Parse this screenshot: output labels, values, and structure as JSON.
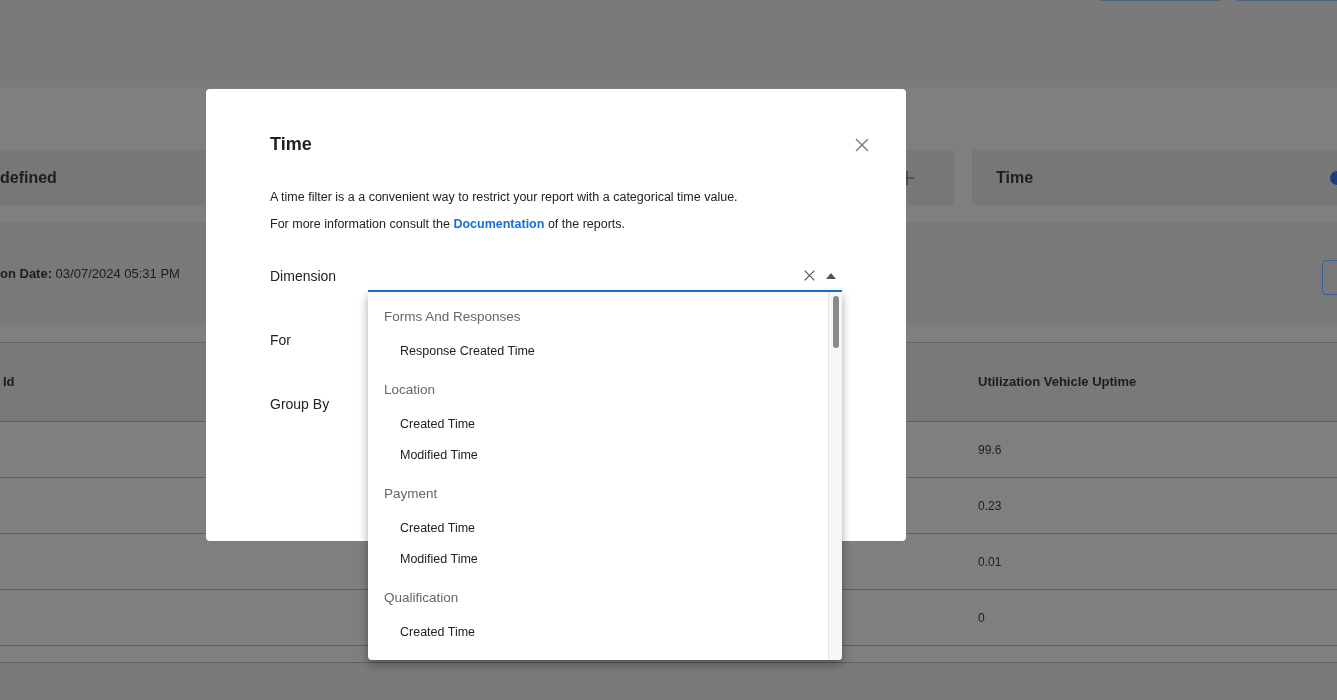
{
  "filter_cards": [
    {
      "kind": "text",
      "label": "defined"
    },
    {
      "kind": "add"
    },
    {
      "kind": "text",
      "label": "Time"
    }
  ],
  "report_info": "**on Date:** 03/07/2024 05:31 PM",
  "table": {
    "columns": [
      "Id",
      "Utilization Vehicle Uptime"
    ],
    "rows": [
      {
        "utilization_vehicle_uptime": "99.6"
      },
      {
        "utilization_vehicle_uptime": "0.23"
      },
      {
        "utilization_vehicle_uptime": "0.01"
      },
      {
        "utilization_vehicle_uptime": "0"
      }
    ]
  },
  "dialog": {
    "title": "Time",
    "description": "A time filter is a a convenient way to restrict your report with a categorical time value.",
    "help": {
      "before": "For more information consult the ",
      "link": "Documentation",
      "after": " of the reports."
    },
    "fields": [
      {
        "label": "Dimension",
        "kind": "select",
        "open": true
      },
      {
        "label": "For"
      },
      {
        "label": "Group By"
      }
    ],
    "dropdown": [
      {
        "group": "Forms And Responses",
        "options": [
          "Response Created Time"
        ]
      },
      {
        "group": "Location",
        "options": [
          "Created Time",
          "Modified Time"
        ]
      },
      {
        "group": "Payment",
        "options": [
          "Created Time",
          "Modified Time"
        ]
      },
      {
        "group": "Qualification",
        "options": [
          "Created Time"
        ]
      }
    ]
  }
}
